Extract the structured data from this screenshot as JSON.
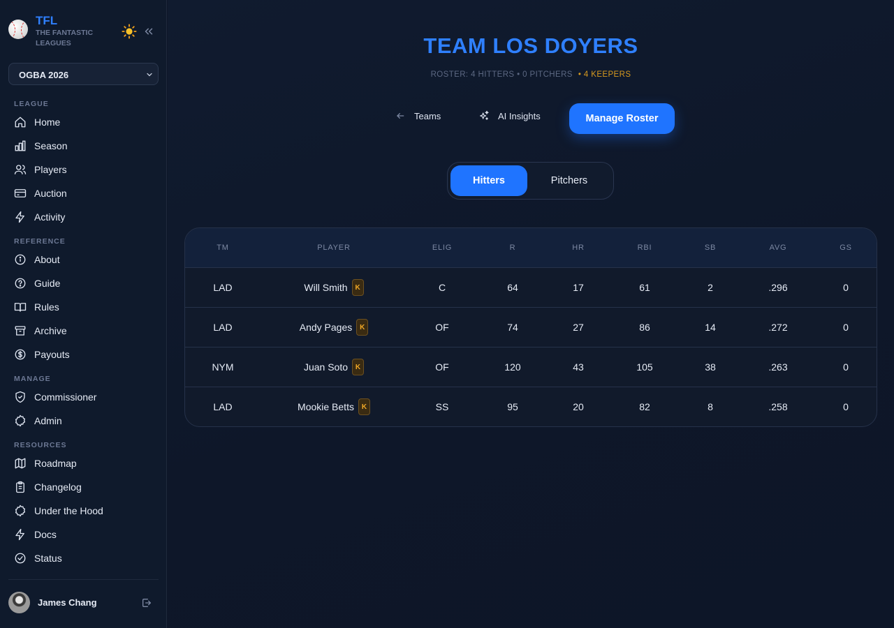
{
  "brand": {
    "title": "TFL",
    "subtitle": "THE FANTASTIC LEAGUES"
  },
  "league_select": {
    "value": "OGBA 2026"
  },
  "nav": {
    "sections": {
      "league": "LEAGUE",
      "reference": "REFERENCE",
      "manage": "MANAGE",
      "resources": "RESOURCES"
    },
    "items": {
      "home": "Home",
      "season": "Season",
      "players": "Players",
      "auction": "Auction",
      "activity": "Activity",
      "about": "About",
      "guide": "Guide",
      "rules": "Rules",
      "archive": "Archive",
      "payouts": "Payouts",
      "commissioner": "Commissioner",
      "admin": "Admin",
      "roadmap": "Roadmap",
      "changelog": "Changelog",
      "under_the_hood": "Under the Hood",
      "docs": "Docs",
      "status": "Status"
    }
  },
  "user": {
    "name": "James Chang"
  },
  "header": {
    "title": "TEAM LOS DOYERS",
    "roster_summary": "ROSTER: 4 HITTERS • 0 PITCHERS",
    "keepers": "• 4 KEEPERS"
  },
  "actions": {
    "teams": "Teams",
    "ai_insights": "AI Insights",
    "manage_roster": "Manage Roster"
  },
  "tabs": {
    "hitters": "Hitters",
    "pitchers": "Pitchers"
  },
  "table": {
    "columns": [
      "TM",
      "PLAYER",
      "ELIG",
      "R",
      "HR",
      "RBI",
      "SB",
      "AVG",
      "GS"
    ],
    "keeper_badge": "K",
    "rows": [
      [
        "LAD",
        "Will Smith",
        "C",
        "64",
        "17",
        "61",
        "2",
        ".296",
        "0"
      ],
      [
        "LAD",
        "Andy Pages",
        "OF",
        "74",
        "27",
        "86",
        "14",
        ".272",
        "0"
      ],
      [
        "NYM",
        "Juan Soto",
        "OF",
        "120",
        "43",
        "105",
        "38",
        ".263",
        "0"
      ],
      [
        "LAD",
        "Mookie Betts",
        "SS",
        "95",
        "20",
        "82",
        "8",
        ".258",
        "0"
      ]
    ]
  },
  "colors": {
    "accent": "#1f74ff",
    "title": "#2f80ff",
    "keeper": "#d79a1f"
  },
  "icons": {
    "home": "home-icon",
    "season": "bar-chart-icon",
    "players": "users-icon",
    "auction": "card-icon",
    "activity": "bolt-icon",
    "about": "info-icon",
    "guide": "help-icon",
    "rules": "book-icon",
    "archive": "archive-icon",
    "payouts": "dollar-icon",
    "commissioner": "shield-icon",
    "admin": "gear-icon",
    "roadmap": "map-icon",
    "changelog": "clipboard-icon",
    "under_the_hood": "cog-icon",
    "docs": "bolt-icon",
    "status": "check-circle-icon"
  }
}
